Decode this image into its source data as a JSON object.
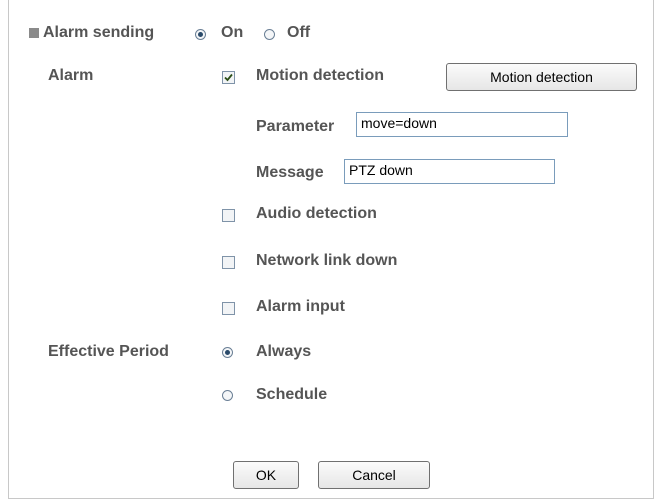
{
  "alarm_sending": {
    "label": "Alarm sending",
    "options": [
      {
        "label": "On",
        "selected": true
      },
      {
        "label": "Off",
        "selected": false
      }
    ]
  },
  "alarm": {
    "label": "Alarm",
    "motion_detection": {
      "label": "Motion detection",
      "checked": true,
      "button_label": "Motion detection",
      "parameter_label": "Parameter",
      "parameter_value": "move=down",
      "message_label": "Message",
      "message_value": "PTZ down"
    },
    "audio_detection": {
      "label": "Audio detection",
      "checked": false
    },
    "network_link_down": {
      "label": "Network link down",
      "checked": false
    },
    "alarm_input": {
      "label": "Alarm input",
      "checked": false
    }
  },
  "effective_period": {
    "label": "Effective Period",
    "options": [
      {
        "label": "Always",
        "selected": true
      },
      {
        "label": "Schedule",
        "selected": false
      }
    ]
  },
  "footer": {
    "ok_label": "OK",
    "cancel_label": "Cancel"
  }
}
